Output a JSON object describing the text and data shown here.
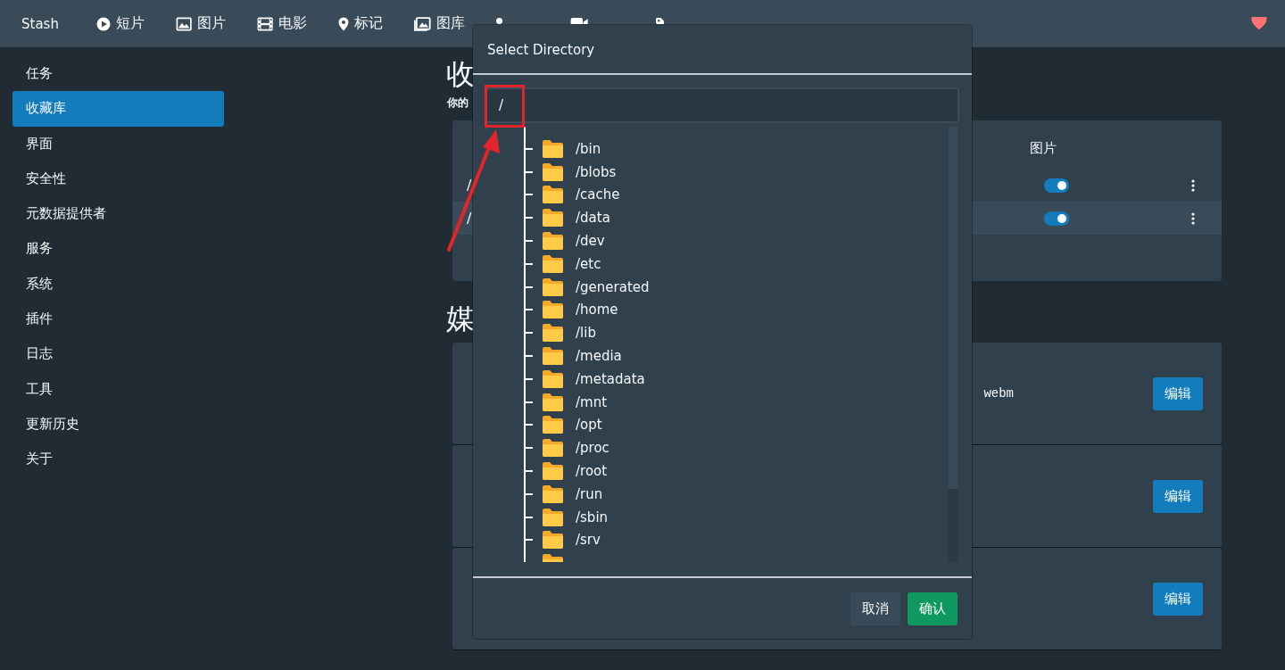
{
  "navbar": {
    "brand": "Stash",
    "items": [
      {
        "kind": "play",
        "label": "短片"
      },
      {
        "kind": "image",
        "label": "图片"
      },
      {
        "kind": "film",
        "label": "电影"
      },
      {
        "kind": "pin",
        "label": "标记"
      },
      {
        "kind": "images",
        "label": "图库"
      },
      {
        "kind": "person"
      },
      {
        "kind": "video"
      },
      {
        "kind": "tag"
      }
    ]
  },
  "sidebar": {
    "items": [
      {
        "label": "任务",
        "selected": false
      },
      {
        "label": "收藏库",
        "selected": true
      },
      {
        "label": "界面",
        "selected": false
      },
      {
        "label": "安全性",
        "selected": false
      },
      {
        "label": "元数据提供者",
        "selected": false
      },
      {
        "label": "服务",
        "selected": false
      },
      {
        "label": "系统",
        "selected": false
      },
      {
        "label": "插件",
        "selected": false
      },
      {
        "label": "日志",
        "selected": false
      },
      {
        "label": "工具",
        "selected": false
      },
      {
        "label": "更新历史",
        "selected": false
      },
      {
        "label": "关于",
        "selected": false
      }
    ]
  },
  "background": {
    "heading_1": "收",
    "subtitle": "你的",
    "column_header": "图片",
    "library_rows": [
      {
        "path": "/",
        "images_enabled": true,
        "hovered": false
      },
      {
        "path": "/",
        "images_enabled": true,
        "hovered": true
      }
    ],
    "heading_2": "媒",
    "cards": [
      {
        "extension": "webm",
        "button": "编辑"
      },
      {
        "button": "编辑"
      },
      {
        "button": "编辑"
      }
    ]
  },
  "dialog": {
    "title": "Select Directory",
    "path_value": "/",
    "directories": [
      "/bin",
      "/blobs",
      "/cache",
      "/data",
      "/dev",
      "/etc",
      "/generated",
      "/home",
      "/lib",
      "/media",
      "/metadata",
      "/mnt",
      "/opt",
      "/proc",
      "/root",
      "/run",
      "/sbin",
      "/srv"
    ],
    "buttons": [
      {
        "label": "取消",
        "kind": "secondary"
      },
      {
        "label": "确认",
        "kind": "primary"
      }
    ]
  }
}
